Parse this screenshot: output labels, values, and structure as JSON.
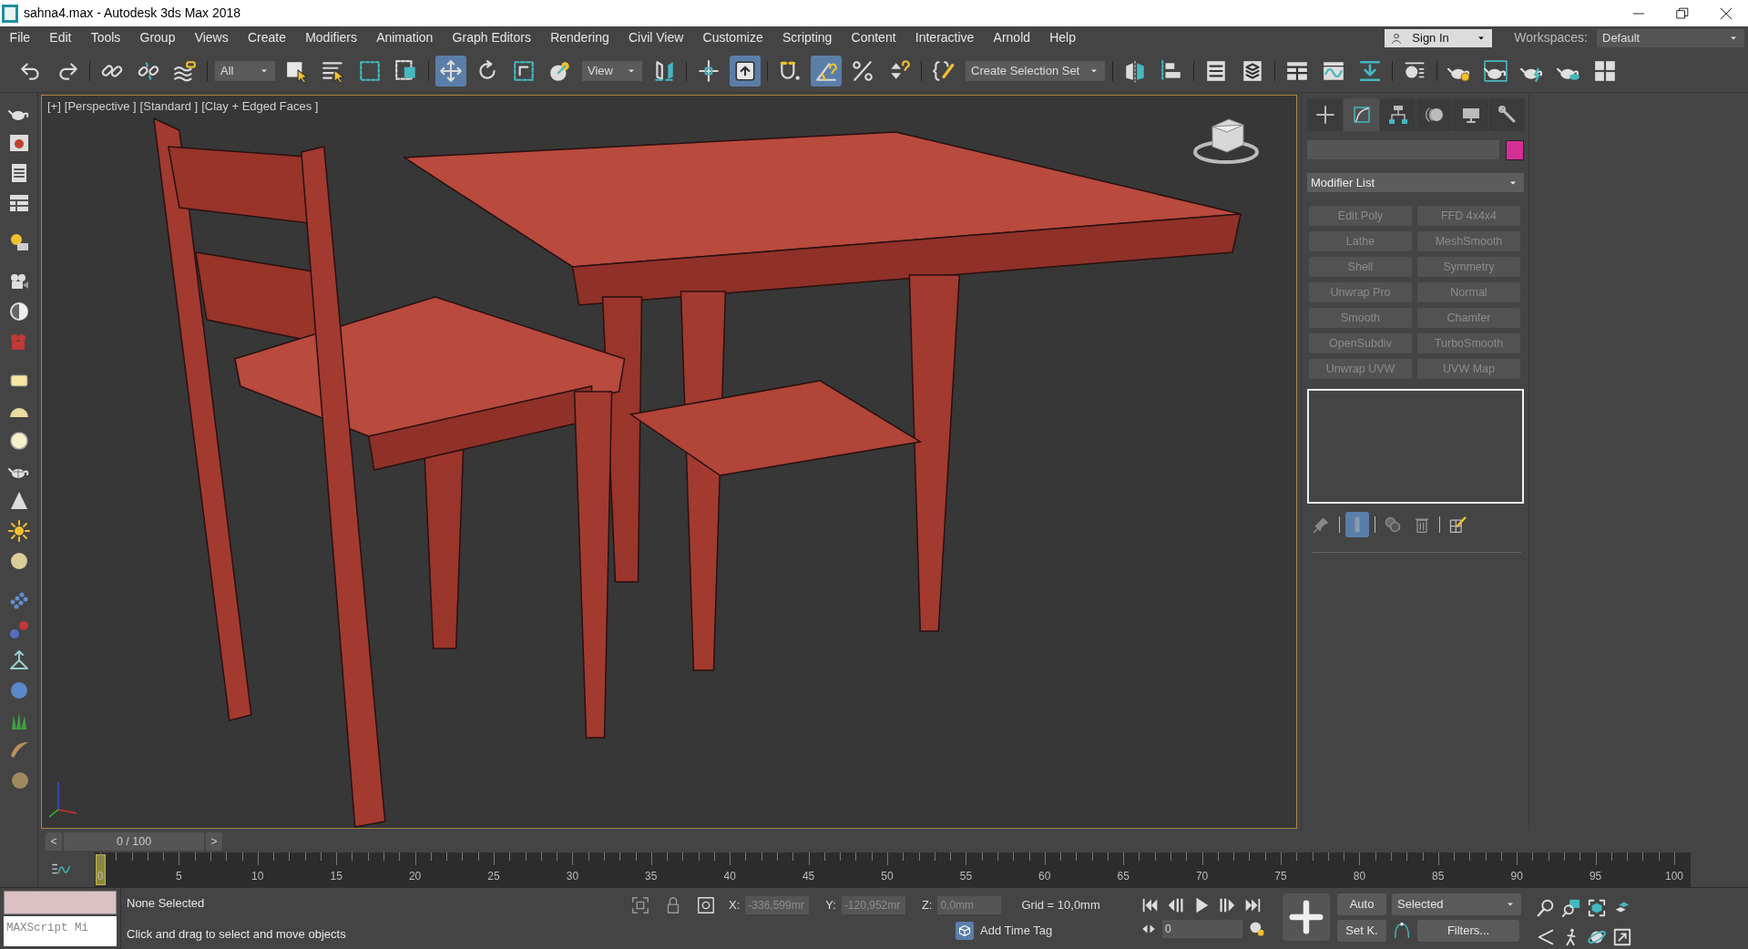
{
  "window": {
    "title": "sahna4.max - Autodesk 3ds Max 2018"
  },
  "menu": [
    "File",
    "Edit",
    "Tools",
    "Group",
    "Views",
    "Create",
    "Modifiers",
    "Animation",
    "Graph Editors",
    "Rendering",
    "Civil View",
    "Customize",
    "Scripting",
    "Content",
    "Interactive",
    "Arnold",
    "Help"
  ],
  "sign_in": {
    "label": "Sign In"
  },
  "workspaces": {
    "label": "Workspaces:",
    "value": "Default"
  },
  "main_toolbar": [
    {
      "kind": "button",
      "selected": false
    },
    {
      "kind": "button",
      "selected": false
    },
    {
      "kind": "separator"
    },
    {
      "kind": "button",
      "selected": false
    },
    {
      "kind": "button",
      "selected": false
    },
    {
      "kind": "button",
      "selected": false
    },
    {
      "kind": "separator"
    },
    {
      "kind": "dropdown",
      "value": "All"
    },
    {
      "kind": "button",
      "selected": false
    },
    {
      "kind": "button",
      "selected": false
    },
    {
      "kind": "button",
      "selected": false
    },
    {
      "kind": "button",
      "selected": false
    },
    {
      "kind": "separator"
    },
    {
      "kind": "button",
      "selected": true
    },
    {
      "kind": "button",
      "selected": false
    },
    {
      "kind": "button",
      "selected": false
    },
    {
      "kind": "button",
      "selected": false
    },
    {
      "kind": "dropdown",
      "value": "View"
    },
    {
      "kind": "button",
      "selected": false
    },
    {
      "kind": "separator"
    },
    {
      "kind": "button",
      "selected": false
    },
    {
      "kind": "button",
      "selected": true
    },
    {
      "kind": "separator"
    },
    {
      "kind": "button",
      "selected": false
    },
    {
      "kind": "button",
      "selected": true
    },
    {
      "kind": "button",
      "selected": false
    },
    {
      "kind": "button",
      "selected": false
    },
    {
      "kind": "separator"
    },
    {
      "kind": "button",
      "selected": false
    },
    {
      "kind": "dropdown",
      "value": "Create Selection Set"
    },
    {
      "kind": "separator"
    },
    {
      "kind": "button",
      "selected": false
    },
    {
      "kind": "button",
      "selected": false
    },
    {
      "kind": "separator"
    },
    {
      "kind": "button",
      "selected": false
    },
    {
      "kind": "button",
      "selected": false
    },
    {
      "kind": "separator"
    },
    {
      "kind": "button",
      "selected": false
    },
    {
      "kind": "button",
      "selected": false
    },
    {
      "kind": "button",
      "selected": false
    },
    {
      "kind": "separator"
    },
    {
      "kind": "button",
      "selected": false
    },
    {
      "kind": "separator"
    },
    {
      "kind": "button",
      "selected": false
    },
    {
      "kind": "button",
      "selected": false
    },
    {
      "kind": "button",
      "selected": false
    },
    {
      "kind": "button",
      "selected": false
    },
    {
      "kind": "button",
      "selected": false
    }
  ],
  "viewport": {
    "labels": [
      "[+]",
      "[Perspective ]",
      "[Standard ]",
      "[Clay + Edged Faces ]"
    ],
    "scene": {
      "kind": "picture"
    }
  },
  "command_panel": {
    "tabs": [
      {
        "selected": false
      },
      {
        "selected": true
      },
      {
        "selected": false
      },
      {
        "selected": false
      },
      {
        "selected": false
      },
      {
        "selected": false
      }
    ],
    "modifier_list": "Modifier List",
    "modifier_buttons": [
      {
        "label": "Edit Poly",
        "disabled": true
      },
      {
        "label": "FFD 4x4x4",
        "disabled": true
      },
      {
        "label": "Lathe",
        "disabled": true
      },
      {
        "label": "MeshSmooth",
        "disabled": true
      },
      {
        "label": "Shell",
        "disabled": true
      },
      {
        "label": "Symmetry",
        "disabled": true
      },
      {
        "label": "Unwrap Pro",
        "disabled": true
      },
      {
        "label": "Normal",
        "disabled": true
      },
      {
        "label": "Smooth",
        "disabled": true
      },
      {
        "label": "Chamfer",
        "disabled": true
      },
      {
        "label": "OpenSubdiv",
        "disabled": true
      },
      {
        "label": "TurboSmooth",
        "disabled": true
      },
      {
        "label": "Unwrap UVW",
        "disabled": true
      },
      {
        "label": "UVW Map",
        "disabled": true
      }
    ],
    "stack_tools": [
      {
        "selected": false
      },
      {
        "selected": true
      },
      {
        "selected": false
      },
      {
        "selected": false
      },
      {
        "selected": false
      }
    ]
  },
  "time_slider": {
    "prev": "<",
    "value": "0 / 100",
    "next": ">"
  },
  "timeline": {
    "labels": [
      "0",
      "5",
      "10",
      "15",
      "20",
      "25",
      "30",
      "35",
      "40",
      "45",
      "50",
      "55",
      "60",
      "65",
      "70",
      "75",
      "80",
      "85",
      "90",
      "95",
      "100"
    ]
  },
  "listener": {
    "value": "MAXScript Mi"
  },
  "status": {
    "selection": "None Selected",
    "prompt": "Click and drag to select and move objects"
  },
  "coords": [
    {
      "label": "X:",
      "value": "-336,599mr",
      "disabled": true
    },
    {
      "label": "Y:",
      "value": "-120,952mr",
      "disabled": true
    },
    {
      "label": "Z:",
      "value": "0,0mm",
      "disabled": true
    }
  ],
  "grid": "Grid = 10,0mm",
  "add_time_tag": "Add Time Tag",
  "current_frame": "0",
  "keys": {
    "auto": "Auto",
    "set_key": "Set K.",
    "key_filter": "Selected",
    "filters": "Filters..."
  }
}
